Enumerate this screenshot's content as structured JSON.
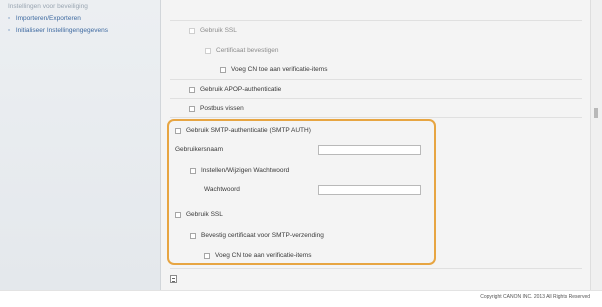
{
  "sidebar": {
    "items": [
      {
        "label": "Instellingen voor beveiliging"
      },
      {
        "label": "Importeren/Exporteren"
      },
      {
        "label": "Initialiseer Instellingengegevens"
      }
    ]
  },
  "form": {
    "use_ssl_label_top": "Gebruik SSL",
    "verify_cert_label": "Certificaat bevestigen",
    "add_cn_label_top": "Voeg CN toe aan verificatie-items",
    "apop_label": "Gebruik APOP-authenticatie",
    "poll_label": "Postbus vissen",
    "smtp_auth_label": "Gebruik SMTP-authenticatie (SMTP AUTH)",
    "username_label": "Gebruikersnaam",
    "username_value": "",
    "set_password_label": "Instellen/Wijzigen Wachtwoord",
    "password_label": "Wachtwoord",
    "password_value": "",
    "use_ssl_label": "Gebruik SSL",
    "verify_cert_smtp_label": "Bevestig certificaat voor SMTP-verzending",
    "add_cn_label": "Voeg CN toe aan verificatie-items"
  },
  "footer": {
    "copyright": "Copyright CANON INC. 2013 All Rights Reserved"
  },
  "colors": {
    "highlight": "#e7a542",
    "link": "#3f6aa1"
  }
}
